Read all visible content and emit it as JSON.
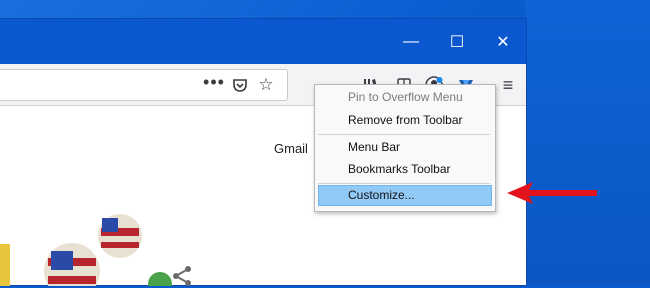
{
  "colors": {
    "desktop_blue": "#0b5fd2",
    "titlebar_blue": "#0b57d0",
    "menu_highlight": "#91c9f7",
    "annotation_red": "#e2131d"
  },
  "titlebar": {
    "minimize_glyph": "—",
    "maximize_glyph": "☐",
    "close_glyph": "✕"
  },
  "toolbar": {
    "page_actions_glyph": "•••",
    "pocket_icon": "pocket-icon",
    "bookmark_star_glyph": "☆",
    "library_icon": "library-icon",
    "reader_icon": "reader-icon",
    "account_icon": "account-icon",
    "extension_icon": "extension-icon",
    "menu_glyph": "≡"
  },
  "page": {
    "gmail_label": "Gmail"
  },
  "context_menu": {
    "items": [
      {
        "label": "Pin to Overflow Menu",
        "disabled": true
      },
      {
        "label": "Remove from Toolbar",
        "disabled": false
      },
      {
        "label": "Menu Bar",
        "disabled": false
      },
      {
        "label": "Bookmarks Toolbar",
        "disabled": false
      },
      {
        "label": "Customize...",
        "disabled": false,
        "highlighted": true
      }
    ]
  }
}
